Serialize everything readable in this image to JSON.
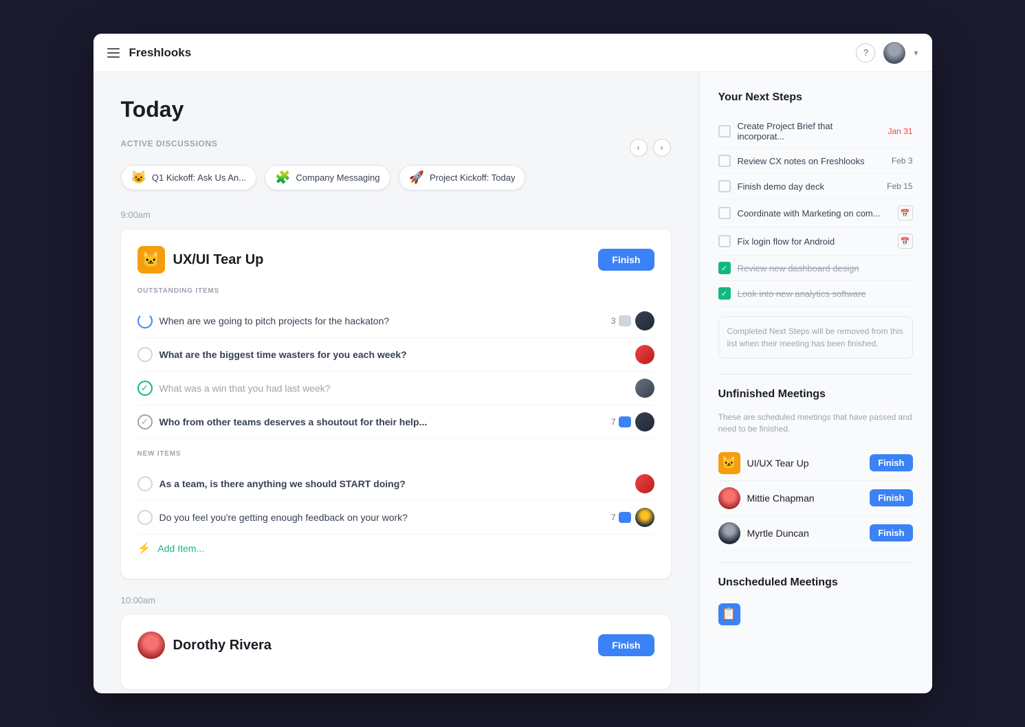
{
  "app": {
    "name": "Freshlooks",
    "header": {
      "help_label": "?",
      "chevron": "▾"
    }
  },
  "page": {
    "title": "Today"
  },
  "active_discussions": {
    "label": "Active Discussions",
    "items": [
      {
        "id": 1,
        "emoji": "😺",
        "title": "Q1 Kickoff: Ask Us An..."
      },
      {
        "id": 2,
        "emoji": "🧩",
        "title": "Company Messaging"
      },
      {
        "id": 3,
        "emoji": "🚀",
        "title": "Project Kickoff: Today"
      }
    ]
  },
  "meetings": [
    {
      "time": "9:00am",
      "title": "UX/UI Tear Up",
      "emoji": "🐱",
      "finish_label": "Finish",
      "outstanding_label": "OUTSTANDING ITEMS",
      "new_label": "NEW ITEMS",
      "outstanding_items": [
        {
          "text": "When are we going to pitch projects for the hackaton?",
          "status": "in-progress",
          "comments": 3,
          "comment_color": "gray",
          "avatar_class": "av-dark"
        },
        {
          "text": "What are the biggest time wasters for you each week?",
          "status": "unchecked",
          "bold": true,
          "comments": null,
          "avatar_class": "av-red"
        },
        {
          "text": "What was a win that you had last week?",
          "status": "checked-green",
          "comments": null,
          "avatar_class": "av-gray"
        },
        {
          "text": "Who from other teams deserves a shoutout for their help...",
          "status": "checked-gray",
          "comments": 7,
          "comment_color": "blue",
          "avatar_class": "av-dark"
        }
      ],
      "new_items": [
        {
          "text": "As a team, is there anything we should START doing?",
          "status": "unchecked",
          "bold": true,
          "comments": null,
          "avatar_class": "av-red"
        },
        {
          "text": "Do you feel you're getting enough feedback on your work?",
          "status": "unchecked",
          "comments": 7,
          "comment_color": "blue",
          "avatar_class": "av-mixed"
        }
      ],
      "add_item_label": "Add Item..."
    },
    {
      "time": "10:00am",
      "title": "Dorothy Rivera",
      "emoji_type": "avatar",
      "finish_label": "Finish"
    }
  ],
  "next_steps": {
    "title": "Your Next Steps",
    "items": [
      {
        "text": "Create Project Brief that incorporat...",
        "date": "Jan 31",
        "date_class": "date-red",
        "checked": false
      },
      {
        "text": "Review CX notes on Freshlooks",
        "date": "Feb 3",
        "date_class": "date-dark",
        "checked": false
      },
      {
        "text": "Finish demo day deck",
        "date": "Feb 15",
        "date_class": "date-dark",
        "checked": false
      },
      {
        "text": "Coordinate with Marketing on com...",
        "date": "calendar",
        "checked": false
      },
      {
        "text": "Fix login flow for Android",
        "date": "calendar",
        "checked": false
      },
      {
        "text": "Review new dashboard design",
        "date": "",
        "checked": true,
        "strikethrough": true
      },
      {
        "text": "Look into new analytics software",
        "date": "",
        "checked": true,
        "strikethrough": true
      }
    ],
    "completed_note": "Completed Next Steps will be removed from this list when their meeting has been finished."
  },
  "unfinished_meetings": {
    "title": "Unfinished Meetings",
    "subtitle": "These are scheduled meetings that have passed and need to be finished.",
    "items": [
      {
        "name": "UI/UX Tear Up",
        "type": "emoji",
        "emoji": "🐱",
        "finish_label": "Finish"
      },
      {
        "name": "Mittie Chapman",
        "type": "avatar",
        "avatar_class": "av-red",
        "finish_label": "Finish"
      },
      {
        "name": "Myrtle Duncan",
        "type": "avatar",
        "avatar_class": "av-dark-round",
        "finish_label": "Finish"
      }
    ]
  },
  "unscheduled_meetings": {
    "title": "Unscheduled Meetings"
  }
}
